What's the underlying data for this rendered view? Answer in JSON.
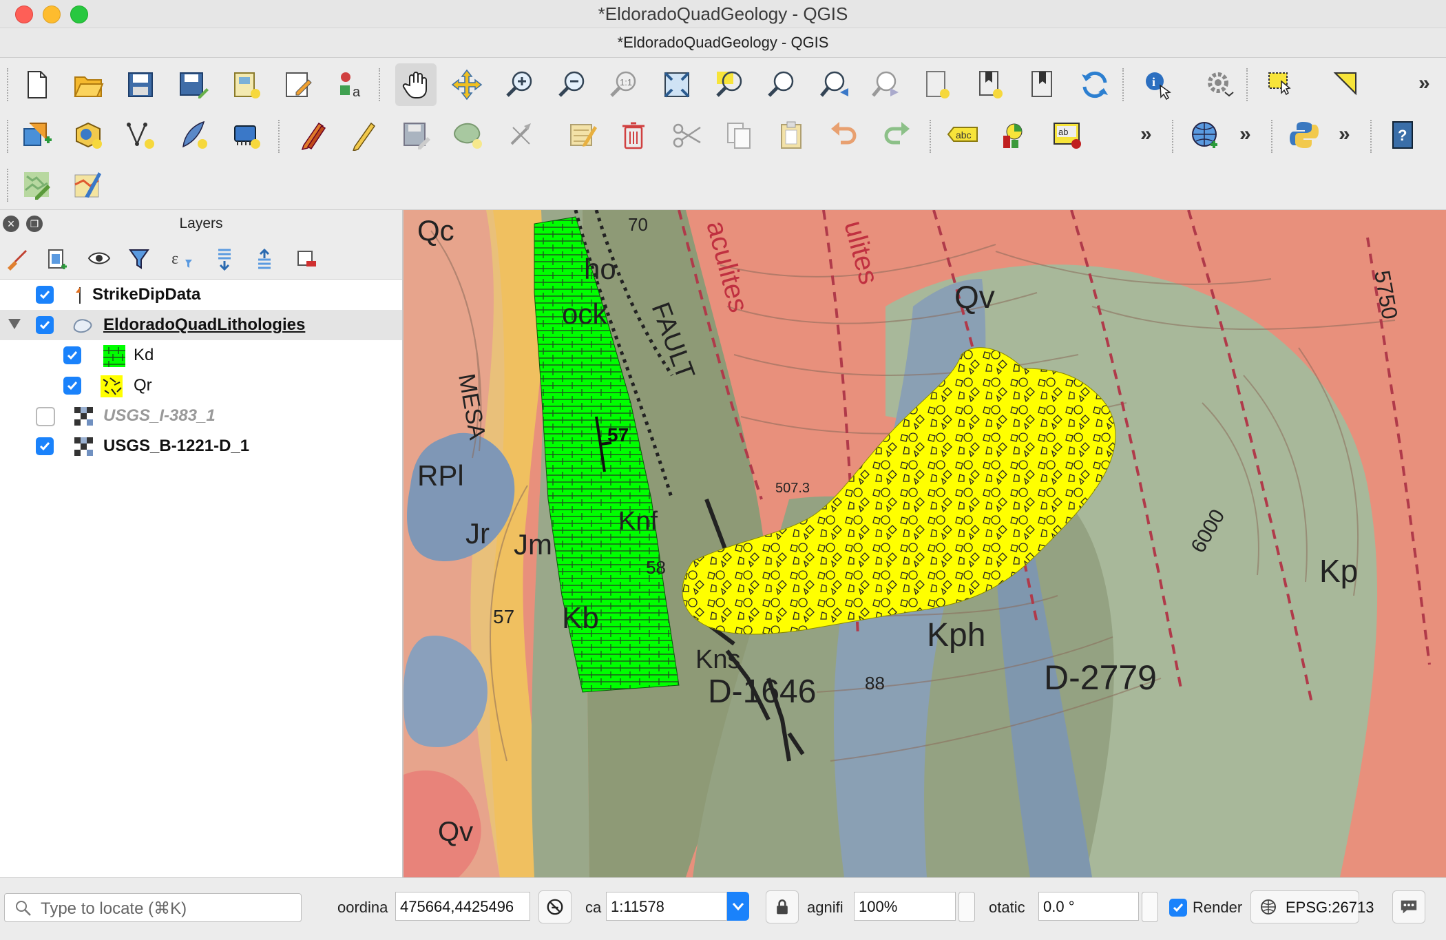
{
  "window": {
    "title": "*EldoradoQuadGeology - QGIS",
    "document_title": "*EldoradoQuadGeology - QGIS"
  },
  "layers_panel": {
    "title": "Layers",
    "layers": [
      {
        "name": "StrikeDipData",
        "checked": true,
        "style": "bold"
      },
      {
        "name": "EldoradoQuadLithologies",
        "checked": true,
        "style": "bold-underline",
        "expanded": true,
        "selected": true
      },
      {
        "name": "Kd",
        "checked": true,
        "child": true,
        "color": "#00ff00"
      },
      {
        "name": "Qr",
        "checked": true,
        "child": true,
        "color": "#ffff00"
      },
      {
        "name": "USGS_I-383_1",
        "checked": false,
        "style": "italic-gray"
      },
      {
        "name": "USGS_B-1221-D_1",
        "checked": true,
        "style": "bold"
      }
    ]
  },
  "map": {
    "labels": {
      "qc": "Qc",
      "qv": "Qv",
      "qv2": "Qv",
      "rpl": "RPl",
      "jr": "Jr",
      "jm": "Jm",
      "knf": "Knf",
      "kb": "Kb",
      "kph": "Kph",
      "kp": "Kp",
      "kns": "Kns",
      "d1646": "D-1646",
      "d2779": "D-2779",
      "fault": "FAULT",
      "mesa": "MESA",
      "ho": "ho",
      "ock": "ock",
      "aculites": "aculites",
      "ulites": "ulites",
      "c5750": "5750",
      "c6000": "6000",
      "c5073": "507.3",
      "n70": "70",
      "n88": "88",
      "n57a": "57",
      "n57b": "57",
      "n58": "58",
      "strike_dip": "57"
    },
    "colors": {
      "kd_fill": "#00ff00",
      "qr_fill": "#ffff00"
    }
  },
  "status_bar": {
    "locate_placeholder": "Type to locate (⌘K)",
    "coordinate_label": "oordina",
    "coordinate_value": "475664,4425496",
    "scale_label": "ca",
    "scale_value": "1:11578",
    "magnifier_label": "agnifi",
    "magnifier_value": "100%",
    "rotation_label": "otatic",
    "rotation_value": "0.0 °",
    "render_label": "Render",
    "render_checked": true,
    "crs": "EPSG:26713"
  }
}
